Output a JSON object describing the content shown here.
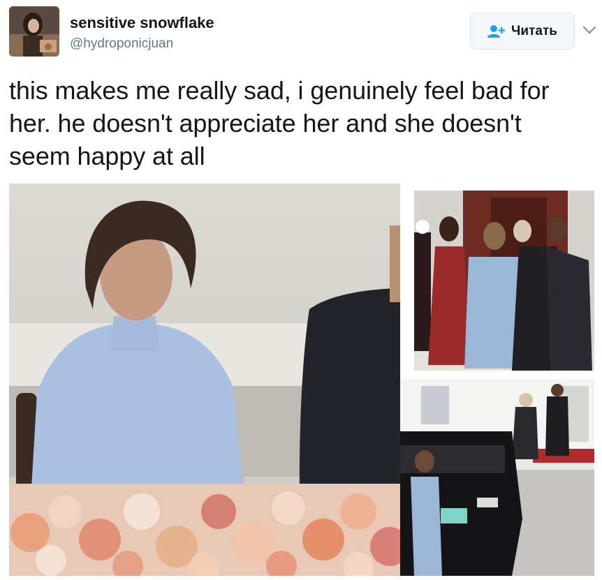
{
  "user": {
    "display_name": "sensitive snowflake",
    "handle": "@hydroponicjuan",
    "avatar_icon": "profile-photo"
  },
  "actions": {
    "follow_label": "Читать",
    "follow_icon": "add-user-icon",
    "menu_icon": "chevron-down-icon"
  },
  "tweet": {
    "text": "this makes me really sad, i genuinely feel bad for her. he doesn't appreciate her and she doesn't seem happy at all"
  },
  "media": {
    "count": 3
  },
  "colors": {
    "text": "#14171a",
    "secondary": "#657786",
    "accent": "#1da1f2",
    "button_bg": "#f5f8fa",
    "border": "#e1e8ed"
  }
}
